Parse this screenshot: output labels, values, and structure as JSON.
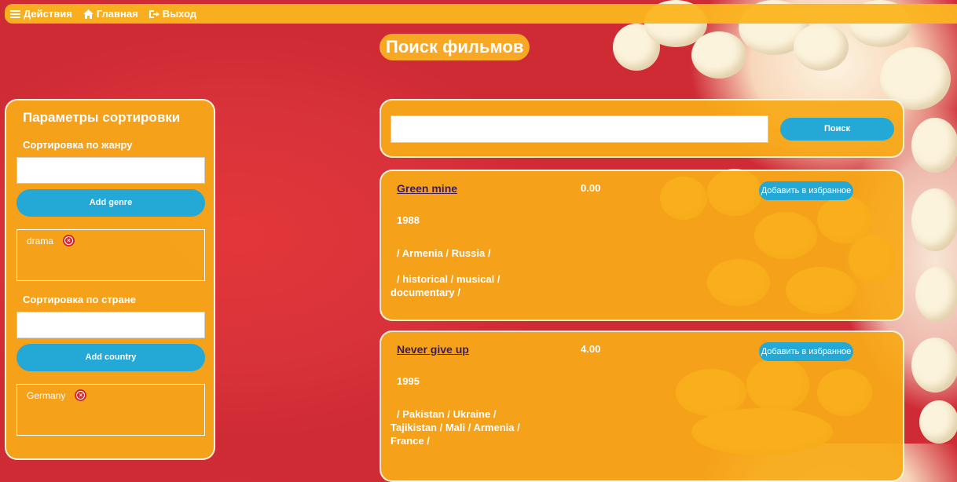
{
  "nav": {
    "actions": "Действия",
    "home": "Главная",
    "logout": "Выход"
  },
  "page_title": "Поиск фильмов",
  "sidebar": {
    "title": "Параметры сортировки",
    "genre_label": "Сортировка по жанру",
    "genre_input_value": "",
    "add_genre": "Add genre",
    "genre_tags": [
      "drama"
    ],
    "country_label": "Сортировка по стране",
    "country_input_value": "",
    "add_country": "Add country",
    "country_tags": [
      "Germany"
    ]
  },
  "search": {
    "value": "",
    "button": "Поиск"
  },
  "movies": [
    {
      "title": "Green mine",
      "rating": "0.00",
      "favorite": "Добавить в избранное",
      "year": "1988",
      "countries": "/ Armenia / Russia /",
      "genres": "/ historical / musical / documentary /"
    },
    {
      "title": "Never give up",
      "rating": "4.00",
      "favorite": "Добавить в избранное",
      "year": "1995",
      "countries": "/ Pakistan / Ukraine / Tajikistan / Mali / Armenia / France /",
      "genres": ""
    }
  ],
  "colors": {
    "background": "#e8343a",
    "panel": "#f8aa18",
    "button": "#24a9d6",
    "link": "#3c1d63"
  }
}
